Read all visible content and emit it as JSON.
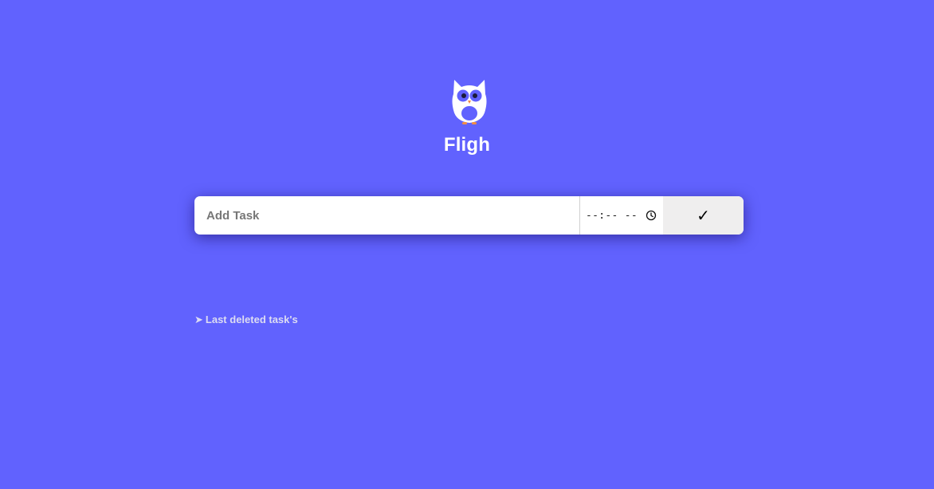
{
  "app": {
    "title": "Fligh",
    "logo_icon": "owl-icon"
  },
  "task_form": {
    "input_placeholder": "Add Task",
    "time_value": "--:-- --",
    "clock_icon": "clock-icon",
    "submit_label": "✓"
  },
  "deleted_section": {
    "arrow": "➤",
    "label": "Last deleted task's"
  },
  "colors": {
    "background": "#6162fe",
    "card": "#ffffff",
    "submit_bg": "#efeeee",
    "owl_accent": "#6162fe",
    "owl_feet": "#f08c45"
  }
}
